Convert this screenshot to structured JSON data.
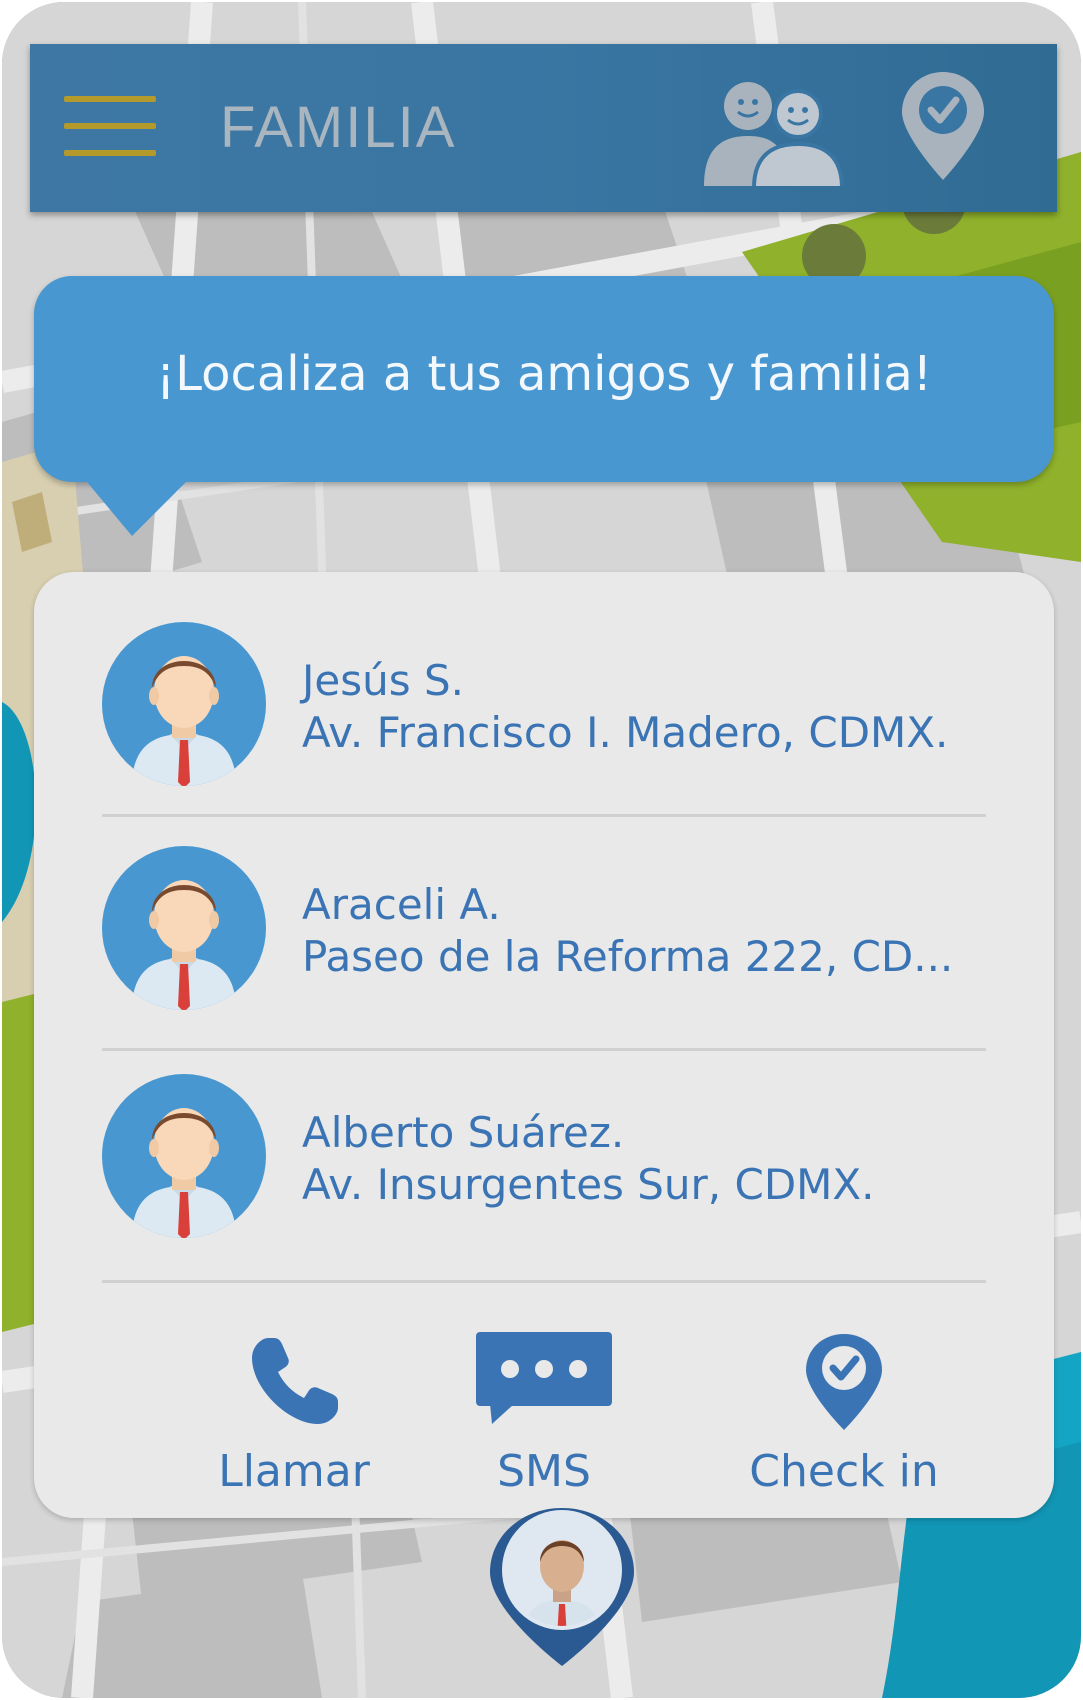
{
  "header": {
    "title": "FAMILIA",
    "menu_icon": "hamburger-icon",
    "group_icon": "people-group-icon",
    "checkin_icon": "location-check-icon"
  },
  "banner": {
    "text": "¡Localiza a tus amigos y familia!"
  },
  "contacts": [
    {
      "name": "Jesús S.",
      "address": "Av. Francisco I. Madero, CDMX."
    },
    {
      "name": "Araceli A.",
      "address": "Paseo de la Reforma 222, CD..."
    },
    {
      "name": "Alberto Suárez.",
      "address": "Av. Insurgentes Sur, CDMX."
    }
  ],
  "actions": {
    "call_label": "Llamar",
    "sms_label": "SMS",
    "checkin_label": "Check in"
  },
  "colors": {
    "header_bg": "#3a76a3",
    "accent_blue": "#3a74b4",
    "bubble_bg": "#4897d0",
    "panel_bg": "#e9e9e9",
    "map_green": "#8fb12b",
    "map_teal": "#1296b6"
  }
}
